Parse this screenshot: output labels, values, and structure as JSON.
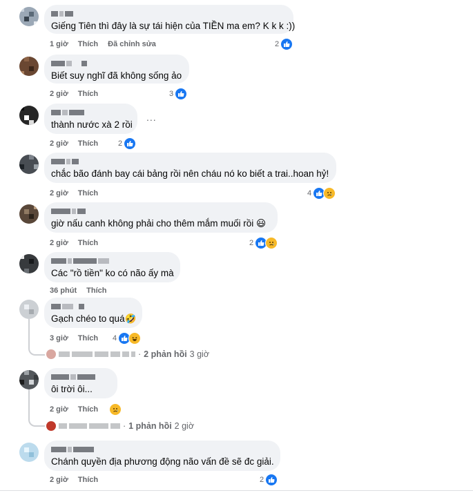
{
  "comments": [
    {
      "text": "Giếng Tiên thì đây là sự tái hiện của TIỀN ma em? K k k :))",
      "time": "1 giờ",
      "like": "Thích",
      "edited": "Đã chỉnh sửa",
      "reaction_count": "2",
      "reactions": [
        "like"
      ]
    },
    {
      "text": "Biết suy nghĩ đã không sống ảo",
      "time": "2 giờ",
      "like": "Thích",
      "reaction_count": "3",
      "reactions": [
        "like"
      ]
    },
    {
      "text": "thành nước xà 2 rồi",
      "time": "2 giờ",
      "like": "Thích",
      "reaction_count": "2",
      "reactions": [
        "like"
      ],
      "more": "..."
    },
    {
      "text": "chắc bão đánh bay cái bảng rồi nên cháu nó ko biết a trai..hoan hỷ!",
      "time": "2 giờ",
      "like": "Thích",
      "reaction_count": "4",
      "reactions": [
        "like",
        "sad"
      ]
    },
    {
      "text": "giờ nấu canh không phải cho thêm mắm muối rồi 😃",
      "time": "2 giờ",
      "like": "Thích",
      "reaction_count": "2",
      "reactions": [
        "like",
        "sad"
      ]
    },
    {
      "text": "Các \"rồ tiền\" ko có não ấy mà",
      "time": "36 phút",
      "like": "Thích"
    },
    {
      "text": "Gạch chéo to quá🤣",
      "time": "3 giờ",
      "like": "Thích",
      "reaction_count": "4",
      "reactions": [
        "like",
        "haha"
      ],
      "replies": {
        "count": "2 phản hồi",
        "time": "3 giờ"
      }
    },
    {
      "text": "ôi trời ôi...",
      "time": "2 giờ",
      "like": "Thích",
      "reactions": [
        "sad"
      ],
      "replies": {
        "count": "1 phản hồi",
        "time": "2 giờ"
      }
    },
    {
      "text": "Chánh quyền địa phương động não vấn đề sẽ đc giải.",
      "time": "2 giờ",
      "like": "Thích",
      "reaction_count": "2",
      "reactions": [
        "like"
      ]
    }
  ],
  "reply_separator": "·",
  "colors": {
    "bubble": "#f0f2f5",
    "like_blue": "#1877f2",
    "emoji_yellow": "#f7b928",
    "meta_gray": "#65676b"
  }
}
